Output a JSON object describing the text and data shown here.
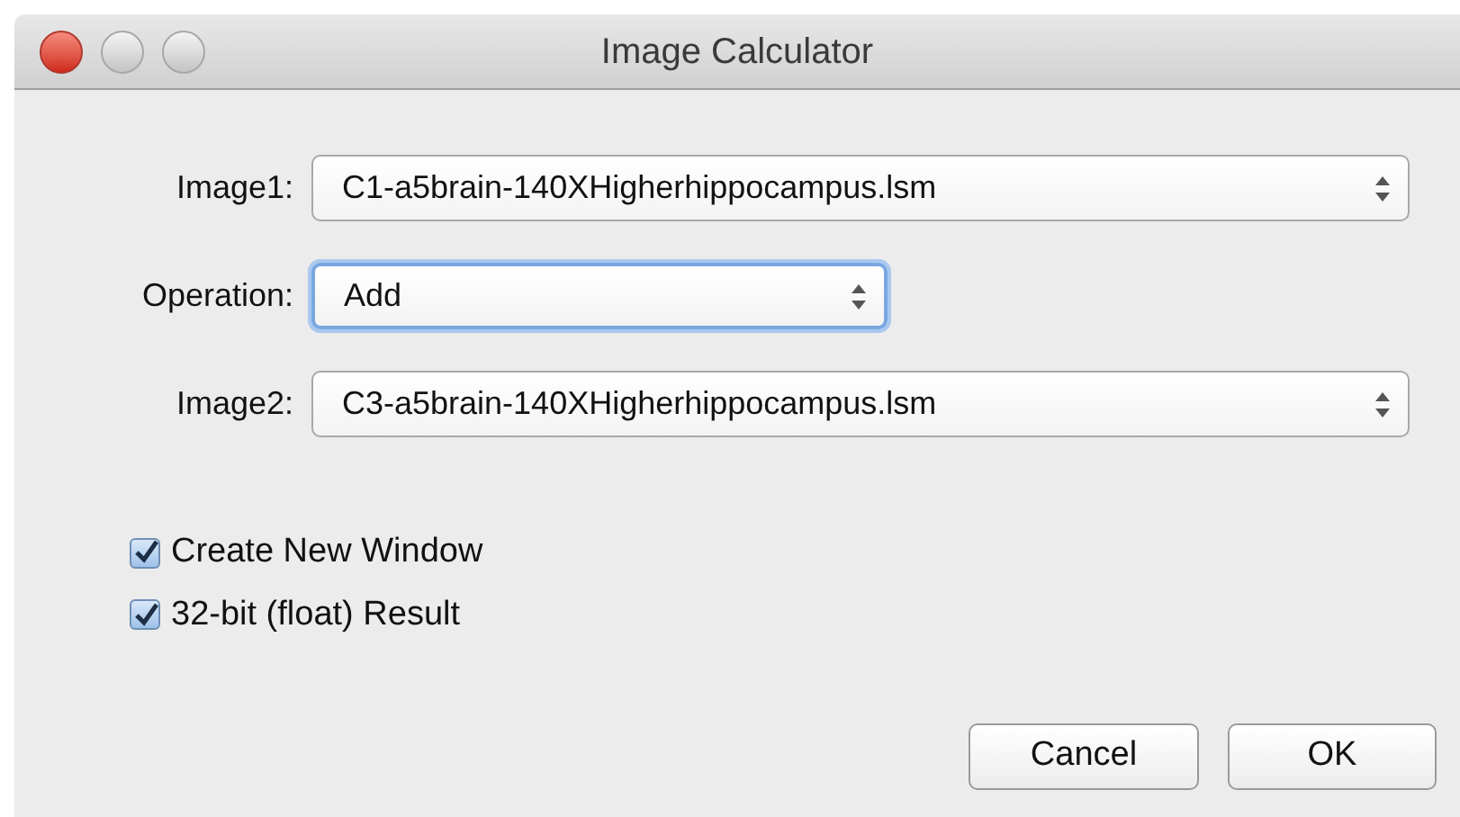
{
  "window": {
    "title": "Image Calculator"
  },
  "fields": [
    {
      "label": "Image1:",
      "value": "C1-a5brain-140XHigherhippocampus.lsm",
      "focused": false,
      "wide": true
    },
    {
      "label": "Operation:",
      "value": "Add",
      "focused": true,
      "wide": false
    },
    {
      "label": "Image2:",
      "value": "C3-a5brain-140XHigherhippocampus.lsm",
      "focused": false,
      "wide": true
    }
  ],
  "checkboxes": [
    {
      "label": "Create New Window",
      "checked": true
    },
    {
      "label": "32-bit (float) Result",
      "checked": true
    }
  ],
  "buttons": [
    "Cancel",
    "OK"
  ]
}
